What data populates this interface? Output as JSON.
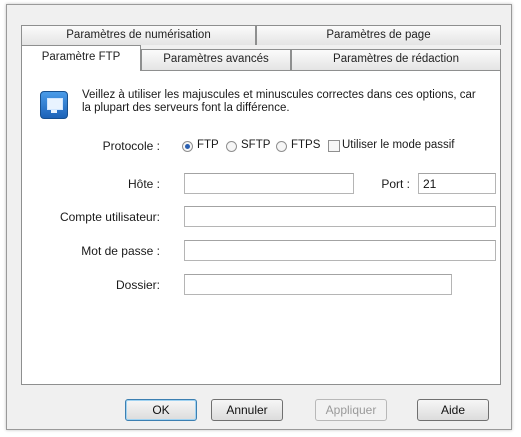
{
  "tabs_back": [
    {
      "label": "Paramètres de numérisation"
    },
    {
      "label": "Paramètres de page"
    }
  ],
  "tabs_front": [
    {
      "label": "Paramètre FTP",
      "active": true
    },
    {
      "label": "Paramètres avancés"
    },
    {
      "label": "Paramètres de rédaction"
    }
  ],
  "info": {
    "icon": "monitor-info-icon",
    "text": "Veillez à utiliser les majuscules et minuscules correctes dans ces options, car la plupart des serveurs font la différence."
  },
  "protocol": {
    "label": "Protocole :",
    "options": [
      {
        "label": "FTP",
        "selected": true
      },
      {
        "label": "SFTP",
        "selected": false
      },
      {
        "label": "FTPS",
        "selected": false
      }
    ],
    "passive_label": "Utiliser le mode passif",
    "passive_checked": false
  },
  "host": {
    "label": "Hôte :",
    "value": ""
  },
  "port": {
    "label": "Port :",
    "value": "21"
  },
  "account": {
    "label": "Compte utilisateur:",
    "value": ""
  },
  "password": {
    "label": "Mot de passe :",
    "value": ""
  },
  "folder": {
    "label": "Dossier:",
    "value": ""
  },
  "buttons": {
    "ok": "OK",
    "cancel": "Annuler",
    "apply": "Appliquer",
    "help": "Aide"
  },
  "colors": {
    "accent": "#2a5fb0",
    "default_button_border": "#3c7fb1"
  }
}
